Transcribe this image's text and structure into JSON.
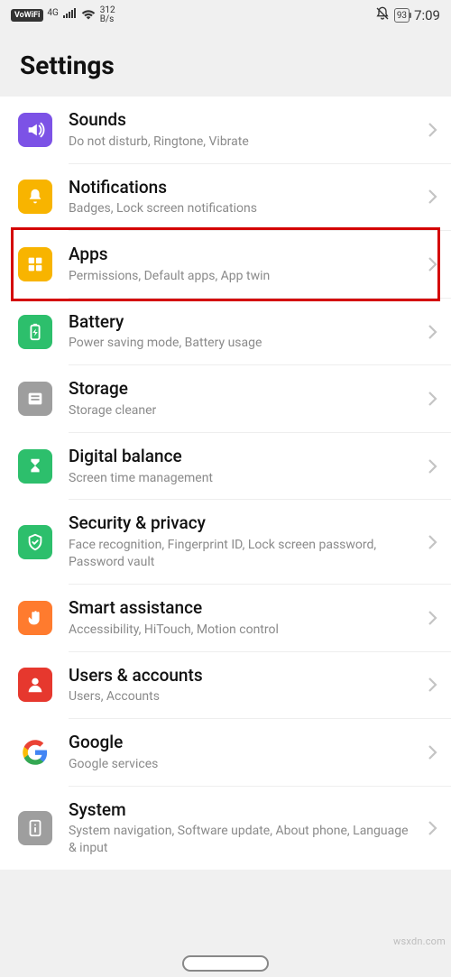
{
  "status": {
    "vowifi": "VoWiFi",
    "net": "4G",
    "speed_top": "312",
    "speed_bot": "B/s",
    "battery": "93",
    "time": "7:09"
  },
  "page_title": "Settings",
  "items": [
    {
      "title": "Sounds",
      "subtitle": "Do not disturb, Ringtone, Vibrate",
      "color": "#7c52e6",
      "icon": "speaker"
    },
    {
      "title": "Notifications",
      "subtitle": "Badges, Lock screen notifications",
      "color": "#f8b400",
      "icon": "bell"
    },
    {
      "title": "Apps",
      "subtitle": "Permissions, Default apps, App twin",
      "color": "#f8b400",
      "icon": "grid"
    },
    {
      "title": "Battery",
      "subtitle": "Power saving mode, Battery usage",
      "color": "#2dbf6c",
      "icon": "battery"
    },
    {
      "title": "Storage",
      "subtitle": "Storage cleaner",
      "color": "#9e9e9e",
      "icon": "disk"
    },
    {
      "title": "Digital balance",
      "subtitle": "Screen time management",
      "color": "#2dbf6c",
      "icon": "hourglass"
    },
    {
      "title": "Security & privacy",
      "subtitle": "Face recognition, Fingerprint ID, Lock screen password, Password vault",
      "color": "#2dbf6c",
      "icon": "shield"
    },
    {
      "title": "Smart assistance",
      "subtitle": "Accessibility, HiTouch, Motion control",
      "color": "#ff7b2e",
      "icon": "hand"
    },
    {
      "title": "Users & accounts",
      "subtitle": "Users, Accounts",
      "color": "#e6382e",
      "icon": "user"
    },
    {
      "title": "Google",
      "subtitle": "Google services",
      "color": "google",
      "icon": "google"
    },
    {
      "title": "System",
      "subtitle": "System navigation, Software update, About phone, Language & input",
      "color": "#9e9e9e",
      "icon": "info"
    }
  ],
  "highlight_index": 2,
  "watermark": "wsxdn.com"
}
